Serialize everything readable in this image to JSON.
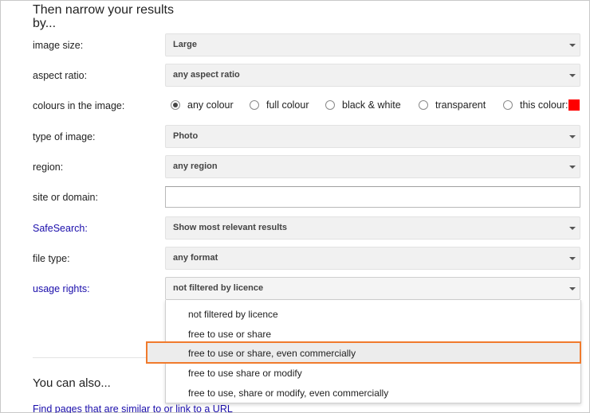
{
  "heading": "Then narrow your results by...",
  "fields": {
    "image_size": {
      "label": "image size:",
      "value": "Large"
    },
    "aspect_ratio": {
      "label": "aspect ratio:",
      "value": "any aspect ratio"
    },
    "colours": {
      "label": "colours in the image:",
      "options": [
        "any colour",
        "full colour",
        "black & white",
        "transparent",
        "this colour:"
      ],
      "selected": "any colour",
      "swatch_color": "#ff0000"
    },
    "type_of_image": {
      "label": "type of image:",
      "value": "Photo"
    },
    "region": {
      "label": "region:",
      "value": "any region"
    },
    "site_domain": {
      "label": "site or domain:",
      "value": ""
    },
    "safesearch": {
      "label": "SafeSearch:",
      "value": "Show most relevant results"
    },
    "file_type": {
      "label": "file type:",
      "value": "any format"
    },
    "usage_rights": {
      "label": "usage rights:",
      "value": "not filtered by licence",
      "options": [
        "not filtered by licence",
        "free to use or share",
        "free to use or share, even commercially",
        "free to use share or modify",
        "free to use, share or modify, even commercially"
      ],
      "highlighted": "free to use or share, even commercially",
      "highlight_color": "#f07a2c"
    }
  },
  "also": {
    "heading": "You can also...",
    "link": "Find pages that are similar to or link to a URL"
  },
  "colors": {
    "link": "#1a0dab"
  }
}
